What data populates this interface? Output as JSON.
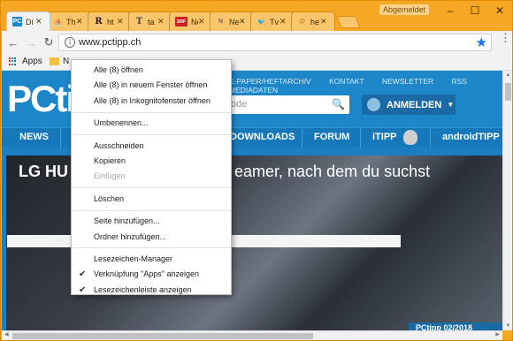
{
  "window": {
    "signed_out": "Abgemeldet",
    "controls": {
      "minimize": "–",
      "maximize": "☐",
      "close": "✕"
    }
  },
  "tabs": [
    {
      "label": "Di",
      "favicon": "PC",
      "favicon_color": "#1c86c8",
      "active": true
    },
    {
      "label": "Th",
      "favicon": "⛵",
      "favicon_color": "#8a6a30",
      "active": false
    },
    {
      "label": "ht",
      "favicon": "R",
      "favicon_color": "#222222",
      "active": false
    },
    {
      "label": "ta",
      "favicon": "T",
      "favicon_color": "#444444",
      "active": false
    },
    {
      "label": "Ne",
      "favicon": "SRF",
      "favicon_color": "#cc2222",
      "active": false
    },
    {
      "label": "Ne",
      "favicon": "N",
      "favicon_color": "#666666",
      "active": false
    },
    {
      "label": "Tv",
      "favicon": "🐦",
      "favicon_color": "#1da1f2",
      "active": false
    },
    {
      "label": "he",
      "favicon": "@",
      "favicon_color": "#c87f30",
      "active": false
    }
  ],
  "toolbar": {
    "back": "←",
    "forward": "→",
    "reload": "↻",
    "url": "www.pctipp.ch",
    "info_icon": "i",
    "star_icon": "★",
    "menu_icon": "⋮"
  },
  "bookmarks": {
    "apps_label": "Apps",
    "folder_label": "N"
  },
  "site": {
    "logo": "PCtipp",
    "top_links": [
      "E-PAPER/HEFTARCHIV",
      "KONTAKT",
      "NEWSLETTER",
      "RSS",
      "MEDIADATEN"
    ],
    "search_placeholder": "ode",
    "search_icon": "🔍",
    "login_label": "ANMELDEN",
    "nav": [
      "NEWS",
      "DOWNLOADS",
      "FORUM",
      "iTIPP",
      "androidTIPP"
    ],
    "hero_title_left": "LG HU",
    "hero_title_right": "eamer, nach dem du suchst",
    "issue_badge": "PCtipp 02/2018"
  },
  "context_menu": {
    "groups": [
      [
        {
          "label": "Alle (8) öffnen",
          "enabled": true
        },
        {
          "label": "Alle (8) in neuem Fenster öffnen",
          "enabled": true
        },
        {
          "label": "Alle (8) in Inkognitofenster öffnen",
          "enabled": true
        }
      ],
      [
        {
          "label": "Umbenennen...",
          "enabled": true
        }
      ],
      [
        {
          "label": "Ausschneiden",
          "enabled": true
        },
        {
          "label": "Kopieren",
          "enabled": true
        },
        {
          "label": "Einfügen",
          "enabled": false
        }
      ],
      [
        {
          "label": "Löschen",
          "enabled": true
        }
      ],
      [
        {
          "label": "Seite hinzufügen...",
          "enabled": true
        },
        {
          "label": "Ordner hinzufügen...",
          "enabled": true
        }
      ],
      [
        {
          "label": "Lesezeichen-Manager",
          "enabled": true,
          "checked": false
        },
        {
          "label": "Verknüpfung \"Apps\" anzeigen",
          "enabled": true,
          "checked": true
        },
        {
          "label": "Lesezeichenleiste anzeigen",
          "enabled": true,
          "checked": true
        }
      ]
    ],
    "check_icon": "✔"
  }
}
